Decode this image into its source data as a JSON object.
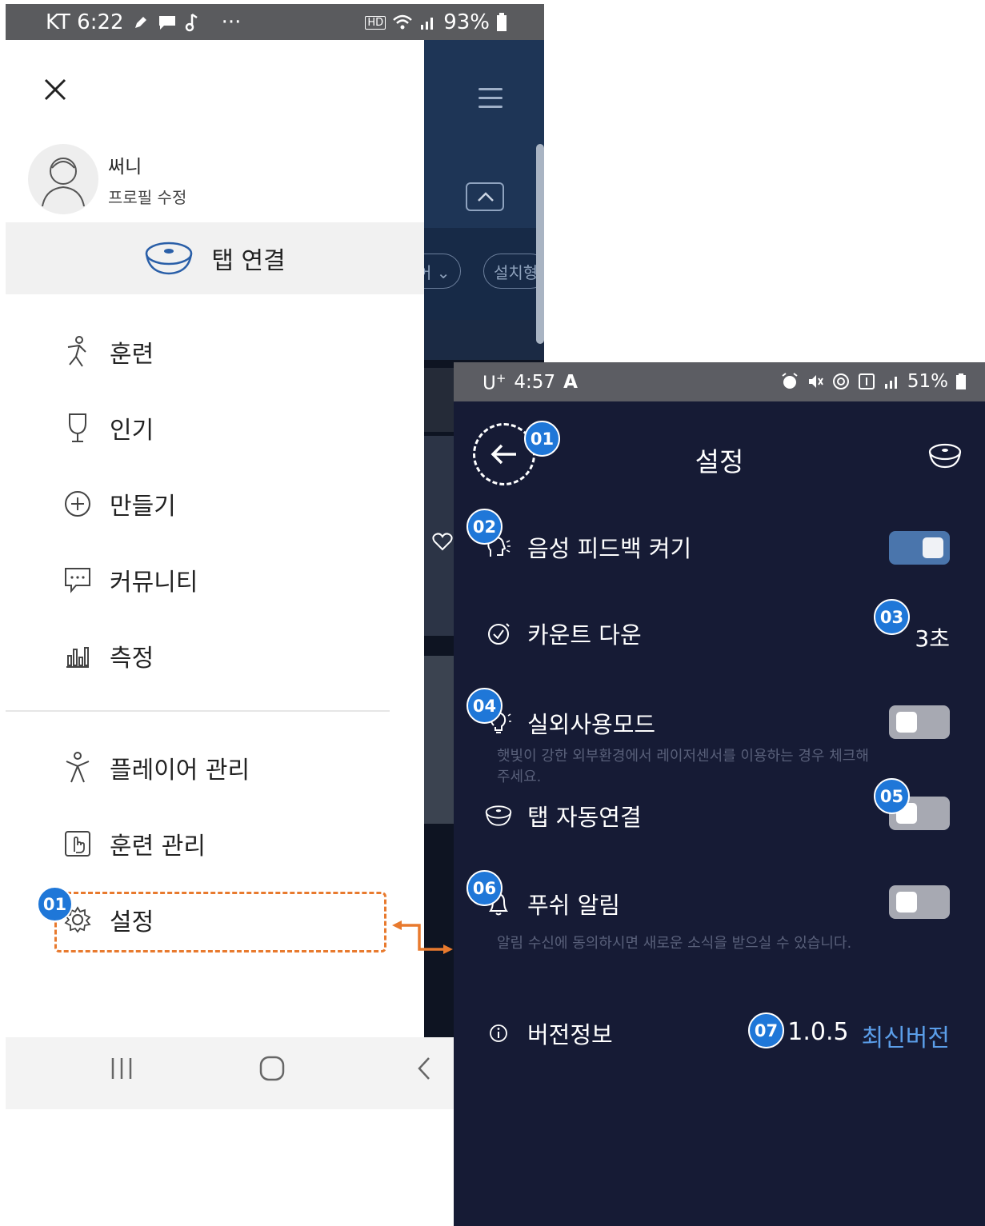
{
  "left_phone": {
    "status": {
      "carrier_time": "KT 6:22",
      "dots": "···",
      "hd": "HD",
      "battery": "93%"
    },
    "background_app": {
      "chip1": "어 ⌄",
      "chip2": "설치형"
    },
    "drawer": {
      "profile_name": "써니",
      "profile_edit": "프로필 수정",
      "connect_label": "탭 연결",
      "menu": {
        "training": "훈련",
        "popular": "인기",
        "create": "만들기",
        "community": "커뮤니티",
        "measure": "측정",
        "player_manage": "플레이어 관리",
        "training_manage": "훈련 관리",
        "settings": "설정"
      }
    },
    "badge": "01"
  },
  "right_phone": {
    "status": {
      "carrier": "U",
      "carrier_sup": "+",
      "time": "4:57",
      "app_letter": "A",
      "battery": "51%"
    },
    "title": "설정",
    "rows": {
      "voice_feedback": "음성 피드백 켜기",
      "countdown": "카운트 다운",
      "countdown_value": "3초",
      "outdoor_mode": "실외사용모드",
      "outdoor_desc": "햇빛이 강한 외부환경에서 레이저센서를 이용하는 경우 체크해주세요.",
      "auto_connect": "탭 자동연결",
      "push": "푸쉬 알림",
      "push_desc": "알림 수신에 동의하시면 새로운 소식을 받으실 수 있습니다.",
      "version": "버전정보",
      "version_number": "1.0.5",
      "version_status": "최신버전"
    },
    "toggles": {
      "voice_feedback": true,
      "outdoor_mode": false,
      "auto_connect": false,
      "push": false
    },
    "badges": {
      "b01": "01",
      "b02": "02",
      "b03": "03",
      "b04": "04",
      "b05": "05",
      "b06": "06",
      "b07": "07"
    }
  },
  "colors": {
    "badge": "#1f77d8",
    "highlight": "#e87a2e",
    "settings_bg": "#161b35",
    "link": "#5b9ee9"
  }
}
